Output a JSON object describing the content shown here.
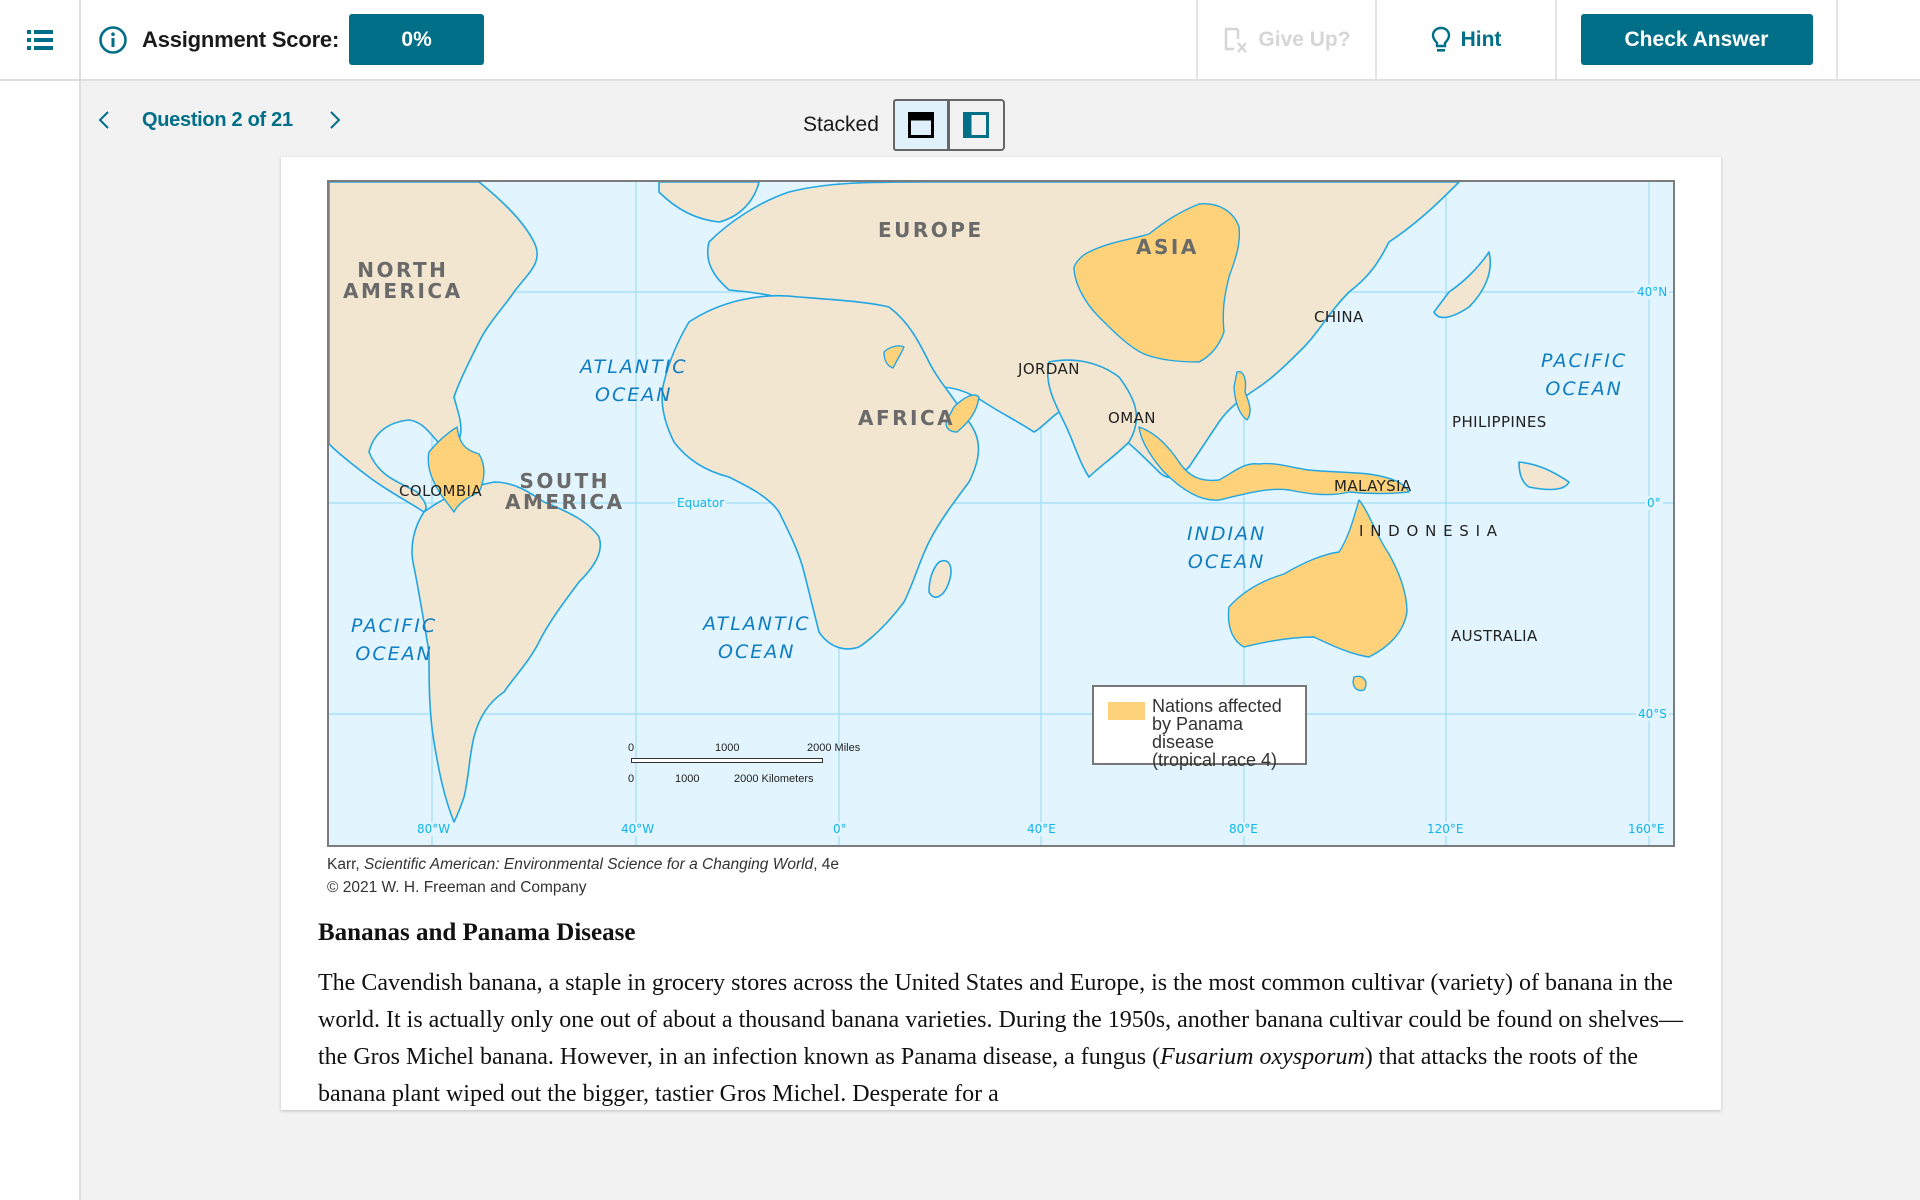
{
  "topbar": {
    "menu_icon": "list-icon",
    "info_icon": "info-icon",
    "score_label": "Assignment Score:",
    "score_value": "0%",
    "give_up_label": "Give Up?",
    "give_up_icon": "give-up-icon",
    "hint_label": "Hint",
    "hint_icon": "lightbulb-icon",
    "check_answer_label": "Check Answer"
  },
  "question_nav": {
    "prev_icon": "chevron-left-icon",
    "label": "Question 2 of 21",
    "next_icon": "chevron-right-icon"
  },
  "layout": {
    "label": "Stacked",
    "options": [
      {
        "name": "stacked",
        "icon": "stacked-layout-icon",
        "active": true
      },
      {
        "name": "side-by-side",
        "icon": "side-by-side-layout-icon",
        "active": false
      }
    ]
  },
  "map": {
    "continents": {
      "north_america": "NORTH\nAMERICA",
      "south_america": "SOUTH\nAMERICA",
      "europe": "EUROPE",
      "asia": "ASIA",
      "africa": "AFRICA"
    },
    "oceans": {
      "atlantic_north": "ATLANTIC\nOCEAN",
      "atlantic_south": "ATLANTIC\nOCEAN",
      "pacific_east": "PACIFIC\nOCEAN",
      "pacific_west": "PACIFIC\nOCEAN",
      "indian": "INDIAN\nOCEAN"
    },
    "countries": {
      "colombia": "COLOMBIA",
      "jordan": "JORDAN",
      "oman": "OMAN",
      "china": "CHINA",
      "philippines": "PHILIPPINES",
      "malaysia": "MALAYSIA",
      "indonesia": "I N D O N E S I A",
      "australia": "AUSTRALIA"
    },
    "equator_label": "Equator",
    "latitudes": [
      "40°N",
      "0°",
      "40°S"
    ],
    "longitudes": [
      "80°W",
      "40°W",
      "0°",
      "40°E",
      "80°E",
      "120°E",
      "160°E"
    ],
    "legend": {
      "color": "#fdd27a",
      "text": "Nations affected\nby Panama disease\n(tropical race 4)"
    },
    "scale": {
      "miles": [
        "0",
        "1000",
        "2000 Miles"
      ],
      "kilometers": [
        "0",
        "1000",
        "2000 Kilometers"
      ]
    },
    "colors": {
      "ocean": "#e2f4fd",
      "land": "#f3e6d0",
      "affected": "#fdd27a",
      "coastline": "#21a6e3",
      "graticule": "#9fdcf5"
    }
  },
  "credit": {
    "author": "Karr, ",
    "book": "Scientific American: Environmental Science for a Changing World",
    "edition": ", 4e",
    "copyright": "© 2021 W. H. Freeman and Company"
  },
  "article": {
    "title": "Bananas and Panama Disease",
    "body_pre": "The Cavendish banana, a staple in grocery stores across the United States and Europe, is the most common cultivar (variety) of banana in the world. It is actually only one out of about a thousand banana varieties. During the 1950s, another banana cultivar could be found on shelves—the Gros Michel banana. However, in an infection known as Panama disease, a fungus (",
    "body_italic": "Fusarium oxysporum",
    "body_post": ") that attacks the roots of the banana plant wiped out the bigger, tastier Gros Michel. Desperate for a"
  }
}
